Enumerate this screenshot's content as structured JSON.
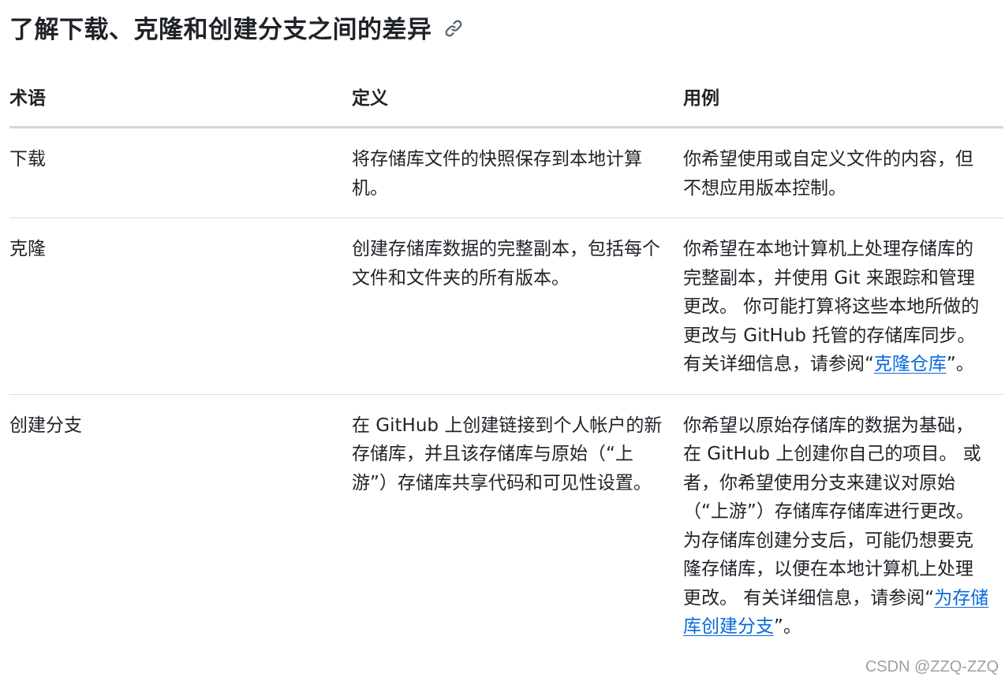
{
  "page": {
    "title": "了解下载、克隆和创建分支之间的差异",
    "anchor_icon": "link-icon"
  },
  "table": {
    "headers": [
      "术语",
      "定义",
      "用例"
    ],
    "rows": [
      {
        "term": "下载",
        "definition": "将存储库文件的快照保存到本地计算机。",
        "use_case": "你希望使用或自定义文件的内容，但不想应用版本控制。"
      },
      {
        "term": "克隆",
        "definition": "创建存储库数据的完整副本，包括每个文件和文件夹的所有版本。",
        "use_case_before": "你希望在本地计算机上处理存储库的完整副本，并使用 Git 来跟踪和管理更改。 你可能打算将这些本地所做的更改与 GitHub 托管的存储库同步。 有关详细信息，请参阅“",
        "use_case_link": "克隆仓库",
        "use_case_after": "”。"
      },
      {
        "term": "创建分支",
        "definition": "在 GitHub 上创建链接到个人帐户的新存储库，并且该存储库与原始（“上游”）存储库共享代码和可见性设置。",
        "use_case_before": "你希望以原始存储库的数据为基础，在 GitHub 上创建你自己的项目。 或者，你希望使用分支来建议对原始（“上游”）存储库存储库进行更改。 为存储库创建分支后，可能仍想要克隆存储库，以便在本地计算机上处理更改。 有关详细信息，请参阅“",
        "use_case_link": "为存储库创建分支",
        "use_case_after": "”。"
      }
    ]
  },
  "watermark": "CSDN @ZZQ-ZZQ",
  "colors": {
    "text": "#1f2328",
    "link": "#0969da",
    "border": "#d0d7de",
    "icon": "#59636e"
  }
}
